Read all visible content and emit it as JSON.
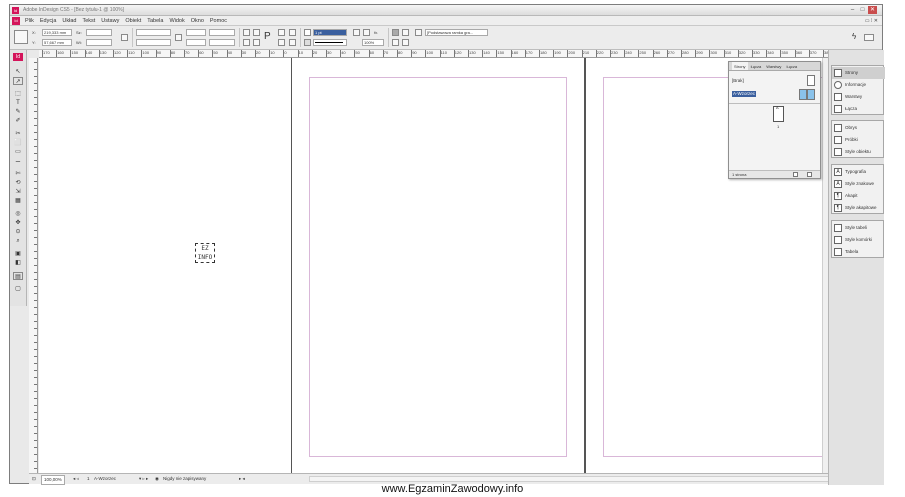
{
  "window": {
    "app_icon": "Id",
    "title": "Adobe InDesign CS5 - [Bez tytułu-1 @ 100%]",
    "minimize": "–",
    "maximize": "□",
    "close": "✕"
  },
  "menubar": {
    "logo": "Id",
    "items": [
      "Plik",
      "Edycja",
      "Układ",
      "Tekst",
      "Ustawy",
      "Obiekt",
      "Tabela",
      "Widok",
      "Okno",
      "Pomoc"
    ],
    "right": "▭ ⁞ ✕"
  },
  "controlbar": {
    "x_label": "X:",
    "x_value": "219,333 mm",
    "y_label": "Y:",
    "y_value": "57,667 mm",
    "w_label": "Sz:",
    "h_label": "Wi:",
    "zoom_value": "100%",
    "stroke_value": "1 pt",
    "frame_style": "[Podstawowa ramka gra...",
    "lightning_icon": "lightning-icon"
  },
  "tools": [
    "↖",
    "↗",
    "⬚",
    "T",
    "✎",
    "✐",
    "✂",
    "⬜",
    "▭",
    "⚊",
    "✄",
    "⟲",
    "⇲",
    "▦",
    "◎",
    "✥",
    "⊙",
    "⌕",
    "▣",
    "◧",
    "▤",
    "▢"
  ],
  "hruler": {
    "labels": [
      "170",
      "160",
      "150",
      "140",
      "130",
      "120",
      "110",
      "100",
      "90",
      "80",
      "70",
      "60",
      "50",
      "40",
      "30",
      "20",
      "10",
      "0",
      "10",
      "20",
      "30",
      "40",
      "50",
      "60",
      "70",
      "80",
      "90",
      "100",
      "110",
      "120",
      "130",
      "140",
      "150",
      "160",
      "170",
      "180",
      "190",
      "200",
      "210",
      "220",
      "230",
      "240",
      "250",
      "260",
      "270",
      "280",
      "290",
      "300",
      "310",
      "320",
      "330",
      "340",
      "350",
      "360",
      "370",
      "380",
      "390",
      "400"
    ]
  },
  "canvas": {
    "placeholder_text": "EZ INFO"
  },
  "pages_panel": {
    "tabs": [
      "Strony",
      "Łącza",
      "Warstwy",
      "Łącza"
    ],
    "none_label": "[Brak]",
    "master_label": "A-Wzorzec",
    "page_letter": "A",
    "page_number": "1",
    "count_label": "1 strona",
    "new_button": "new-page-icon",
    "delete_button": "trash-icon"
  },
  "dock": {
    "group1": [
      "Strony",
      "Informacje",
      "Warstwy",
      "Łącza"
    ],
    "group2": [
      "Obrys",
      "Próbki",
      "Style obiektu"
    ],
    "group3": [
      "Typografia",
      "Style znakowe",
      "Akapit",
      "Style akapitowe"
    ],
    "group4": [
      "Style tabeli",
      "Style komórki",
      "Tabela"
    ]
  },
  "statusbar": {
    "zoom": "100,00%",
    "page": "1",
    "master": "A-Wzorzec",
    "errors": "Nigdy nie zapisywany"
  },
  "watermark": "www.EgzaminZawodowy.info"
}
